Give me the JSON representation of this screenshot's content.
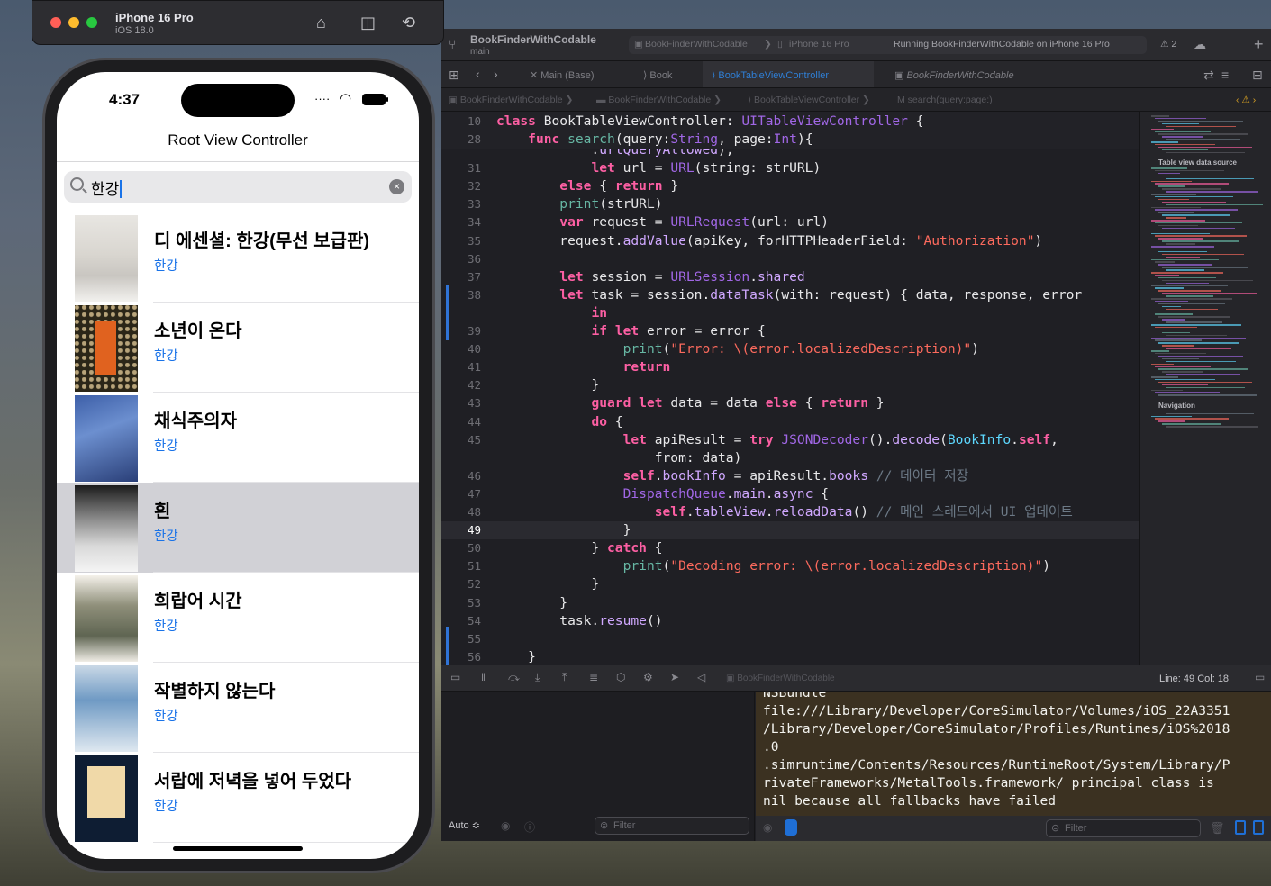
{
  "simulator": {
    "device_name": "iPhone 16 Pro",
    "os_version": "iOS 18.0",
    "buttons": [
      "home-icon",
      "screenshot-icon",
      "rotate-icon"
    ],
    "status_time": "4:37",
    "nav_title": "Root View Controller",
    "search": {
      "value": "한강"
    },
    "books": [
      {
        "title": "디 에센셜: 한강(무선 보급판)",
        "author": "한강"
      },
      {
        "title": "소년이 온다",
        "author": "한강"
      },
      {
        "title": "채식주의자",
        "author": "한강"
      },
      {
        "title": "흰",
        "author": "한강",
        "selected": true
      },
      {
        "title": "희랍어 시간",
        "author": "한강"
      },
      {
        "title": "작별하지 않는다",
        "author": "한강"
      },
      {
        "title": "서랍에 저녁을 넣어 두었다",
        "author": "한강"
      }
    ]
  },
  "xcode": {
    "project_name": "BookFinderWithCodable",
    "branch": "main",
    "scheme": "BookFinderWithCodable",
    "destination": "iPhone 16 Pro",
    "status": "Running BookFinderWithCodable on iPhone 16 Pro",
    "warning_count": "2",
    "tabs": [
      "Main (Base)",
      "Book",
      "BookTableViewController",
      "BookFinderWithCodable"
    ],
    "active_tab_index": 2,
    "breadcrumbs": [
      "BookFinderWithCodable",
      "BookFinderWithCodable",
      "BookTableViewController",
      "search(query:page:)"
    ],
    "current_line": "49",
    "minimap_labels": [
      "Table view data source",
      "Navigation"
    ],
    "debug_target": "BookFinderWithCodable",
    "cursor_position": "Line: 49  Col: 18",
    "variables_scope": "Auto ≎",
    "variables_filter_placeholder": "Filter",
    "console_filter_placeholder": "Filter",
    "console_lines": [
      "NSBundle",
      "file:///Library/Developer/CoreSimulator/Volumes/iOS_22A3351",
      "/Library/Developer/CoreSimulator/Profiles/Runtimes/iOS%2018",
      ".0",
      ".simruntime/Contents/Resources/RuntimeRoot/System/Library/P",
      "rivateFrameworks/MetalTools.framework/ principal class is",
      "nil because all fallbacks have failed"
    ],
    "code_lines": [
      {
        "n": "10",
        "t": "class BookTableViewController: UITableViewController {"
      },
      {
        "n": "28",
        "t": "    func search(query:String, page:Int){"
      },
      {
        "n": "",
        "t": "            .urlQueryAllowed),"
      },
      {
        "n": "31",
        "t": "            let url = URL(string: strURL)"
      },
      {
        "n": "32",
        "t": "        else { return }"
      },
      {
        "n": "33",
        "t": "        print(strURL)"
      },
      {
        "n": "34",
        "t": "        var request = URLRequest(url: url)"
      },
      {
        "n": "35",
        "t": "        request.addValue(apiKey, forHTTPHeaderField: \"Authorization\")"
      },
      {
        "n": "36",
        "t": ""
      },
      {
        "n": "37",
        "t": "        let session = URLSession.shared"
      },
      {
        "n": "38",
        "t": "        let task = session.dataTask(with: request) { data, response, error"
      },
      {
        "n": "",
        "t": "            in"
      },
      {
        "n": "39",
        "t": "            if let error = error {"
      },
      {
        "n": "40",
        "t": "                print(\"Error: \\(error.localizedDescription)\")"
      },
      {
        "n": "41",
        "t": "                return"
      },
      {
        "n": "42",
        "t": "            }"
      },
      {
        "n": "43",
        "t": "            guard let data = data else { return }"
      },
      {
        "n": "44",
        "t": "            do {"
      },
      {
        "n": "45",
        "t": "                let apiResult = try JSONDecoder().decode(BookInfo.self,"
      },
      {
        "n": "",
        "t": "                    from: data)"
      },
      {
        "n": "46",
        "t": "                self.bookInfo = apiResult.books // 데이터 저장"
      },
      {
        "n": "47",
        "t": "                DispatchQueue.main.async {"
      },
      {
        "n": "48",
        "t": "                    self.tableView.reloadData() // 메인 스레드에서 UI 업데이트"
      },
      {
        "n": "49",
        "t": "                }"
      },
      {
        "n": "50",
        "t": "            } catch {"
      },
      {
        "n": "51",
        "t": "                print(\"Decoding error: \\(error.localizedDescription)\")"
      },
      {
        "n": "52",
        "t": "            }"
      },
      {
        "n": "53",
        "t": "        }"
      },
      {
        "n": "54",
        "t": "        task.resume()"
      },
      {
        "n": "55",
        "t": ""
      },
      {
        "n": "56",
        "t": "    }"
      }
    ]
  }
}
